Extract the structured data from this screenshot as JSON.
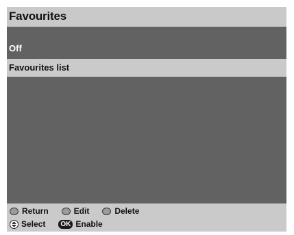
{
  "header": {
    "title": "Favourites"
  },
  "menu": {
    "items": [
      {
        "label": "Off",
        "selected": false
      },
      {
        "label": "Favourites list",
        "selected": true
      }
    ]
  },
  "footer": {
    "row1": [
      {
        "icon": "return-button-icon",
        "label": "Return"
      },
      {
        "icon": "edit-button-icon",
        "label": "Edit"
      },
      {
        "icon": "delete-button-icon",
        "label": "Delete"
      }
    ],
    "row2": [
      {
        "icon": "up-down-icon",
        "label": "Select"
      },
      {
        "icon": "ok-icon",
        "badge": "OK",
        "label": "Enable"
      }
    ]
  },
  "colors": {
    "panel": "#626262",
    "bar": "#c9c9c9",
    "highlight": "#cacaca",
    "text_light": "#ffffff",
    "text_dark": "#111111"
  }
}
